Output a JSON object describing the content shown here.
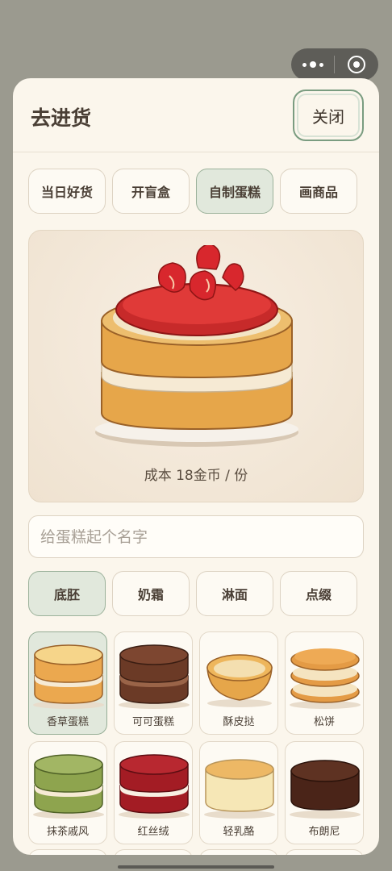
{
  "window": {
    "title": "去进货",
    "close_label": "关闭"
  },
  "tabs": [
    {
      "label": "当日好货",
      "active": false
    },
    {
      "label": "开盲盒",
      "active": false
    },
    {
      "label": "自制蛋糕",
      "active": true
    },
    {
      "label": "画商品",
      "active": false
    }
  ],
  "preview": {
    "cost_text": "成本 18金币 / 份"
  },
  "name_input": {
    "placeholder": "给蛋糕起个名字",
    "value": ""
  },
  "subtabs": [
    {
      "label": "底胚",
      "active": true
    },
    {
      "label": "奶霜",
      "active": false
    },
    {
      "label": "淋面",
      "active": false
    },
    {
      "label": "点缀",
      "active": false
    }
  ],
  "bases": [
    {
      "label": "香草蛋糕",
      "selected": true,
      "icon": "vanilla-sponge-icon"
    },
    {
      "label": "可可蛋糕",
      "selected": false,
      "icon": "cocoa-sponge-icon"
    },
    {
      "label": "酥皮挞",
      "selected": false,
      "icon": "tart-shell-icon"
    },
    {
      "label": "松饼",
      "selected": false,
      "icon": "pancake-stack-icon"
    },
    {
      "label": "抹茶戚风",
      "selected": false,
      "icon": "matcha-chiffon-icon"
    },
    {
      "label": "红丝绒",
      "selected": false,
      "icon": "red-velvet-icon"
    },
    {
      "label": "轻乳酪",
      "selected": false,
      "icon": "cheesecake-icon"
    },
    {
      "label": "布朗尼",
      "selected": false,
      "icon": "brownie-icon"
    }
  ]
}
